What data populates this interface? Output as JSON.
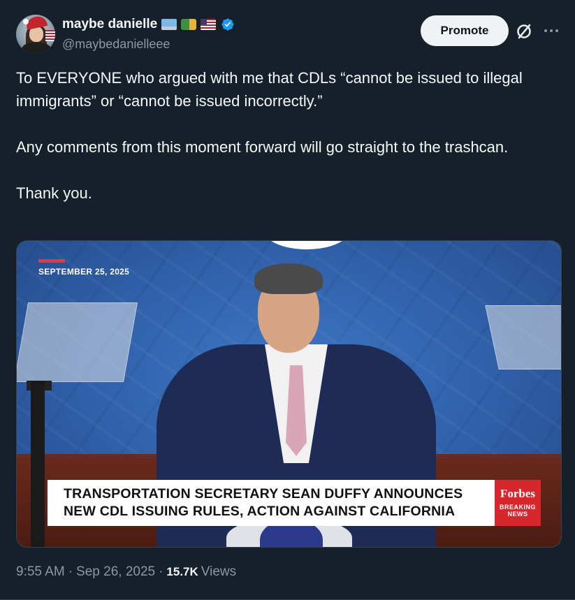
{
  "author": {
    "display_name": "maybe danielle",
    "handle": "@maybedanielleee",
    "emoji": [
      "laptop-emoji",
      "truck-emoji",
      "us-flag-emoji"
    ],
    "verified": true
  },
  "header": {
    "promote_label": "Promote",
    "grok_icon": "grok-icon",
    "more_icon": "more-dots-icon"
  },
  "tweet": {
    "paragraphs": [
      "To EVERYONE who argued with me that CDLs “cannot be issued to illegal immigrants” or “cannot be issued incorrectly.”",
      "Any comments from this moment forward will go straight to the trashcan.",
      "Thank you."
    ]
  },
  "media": {
    "date_overlay": "SEPTEMBER 25, 2025",
    "headline_line1": "TRANSPORTATION SECRETARY SEAN DUFFY ANNOUNCES",
    "headline_line2": "NEW CDL ISSUING RULES, ACTION AGAINST CALIFORNIA",
    "brand": "Forbes",
    "brand_sub1": "BREAKING",
    "brand_sub2": "NEWS"
  },
  "meta": {
    "time": "9:55 AM",
    "date": "Sep 26, 2025",
    "views_count": "15.7K",
    "views_label": "Views",
    "separator": "·"
  },
  "colors": {
    "background": "#15202b",
    "text": "#f7f9f9",
    "muted": "#8b98a5",
    "verified": "#1d9bf0",
    "forbes_red": "#d7262c"
  }
}
